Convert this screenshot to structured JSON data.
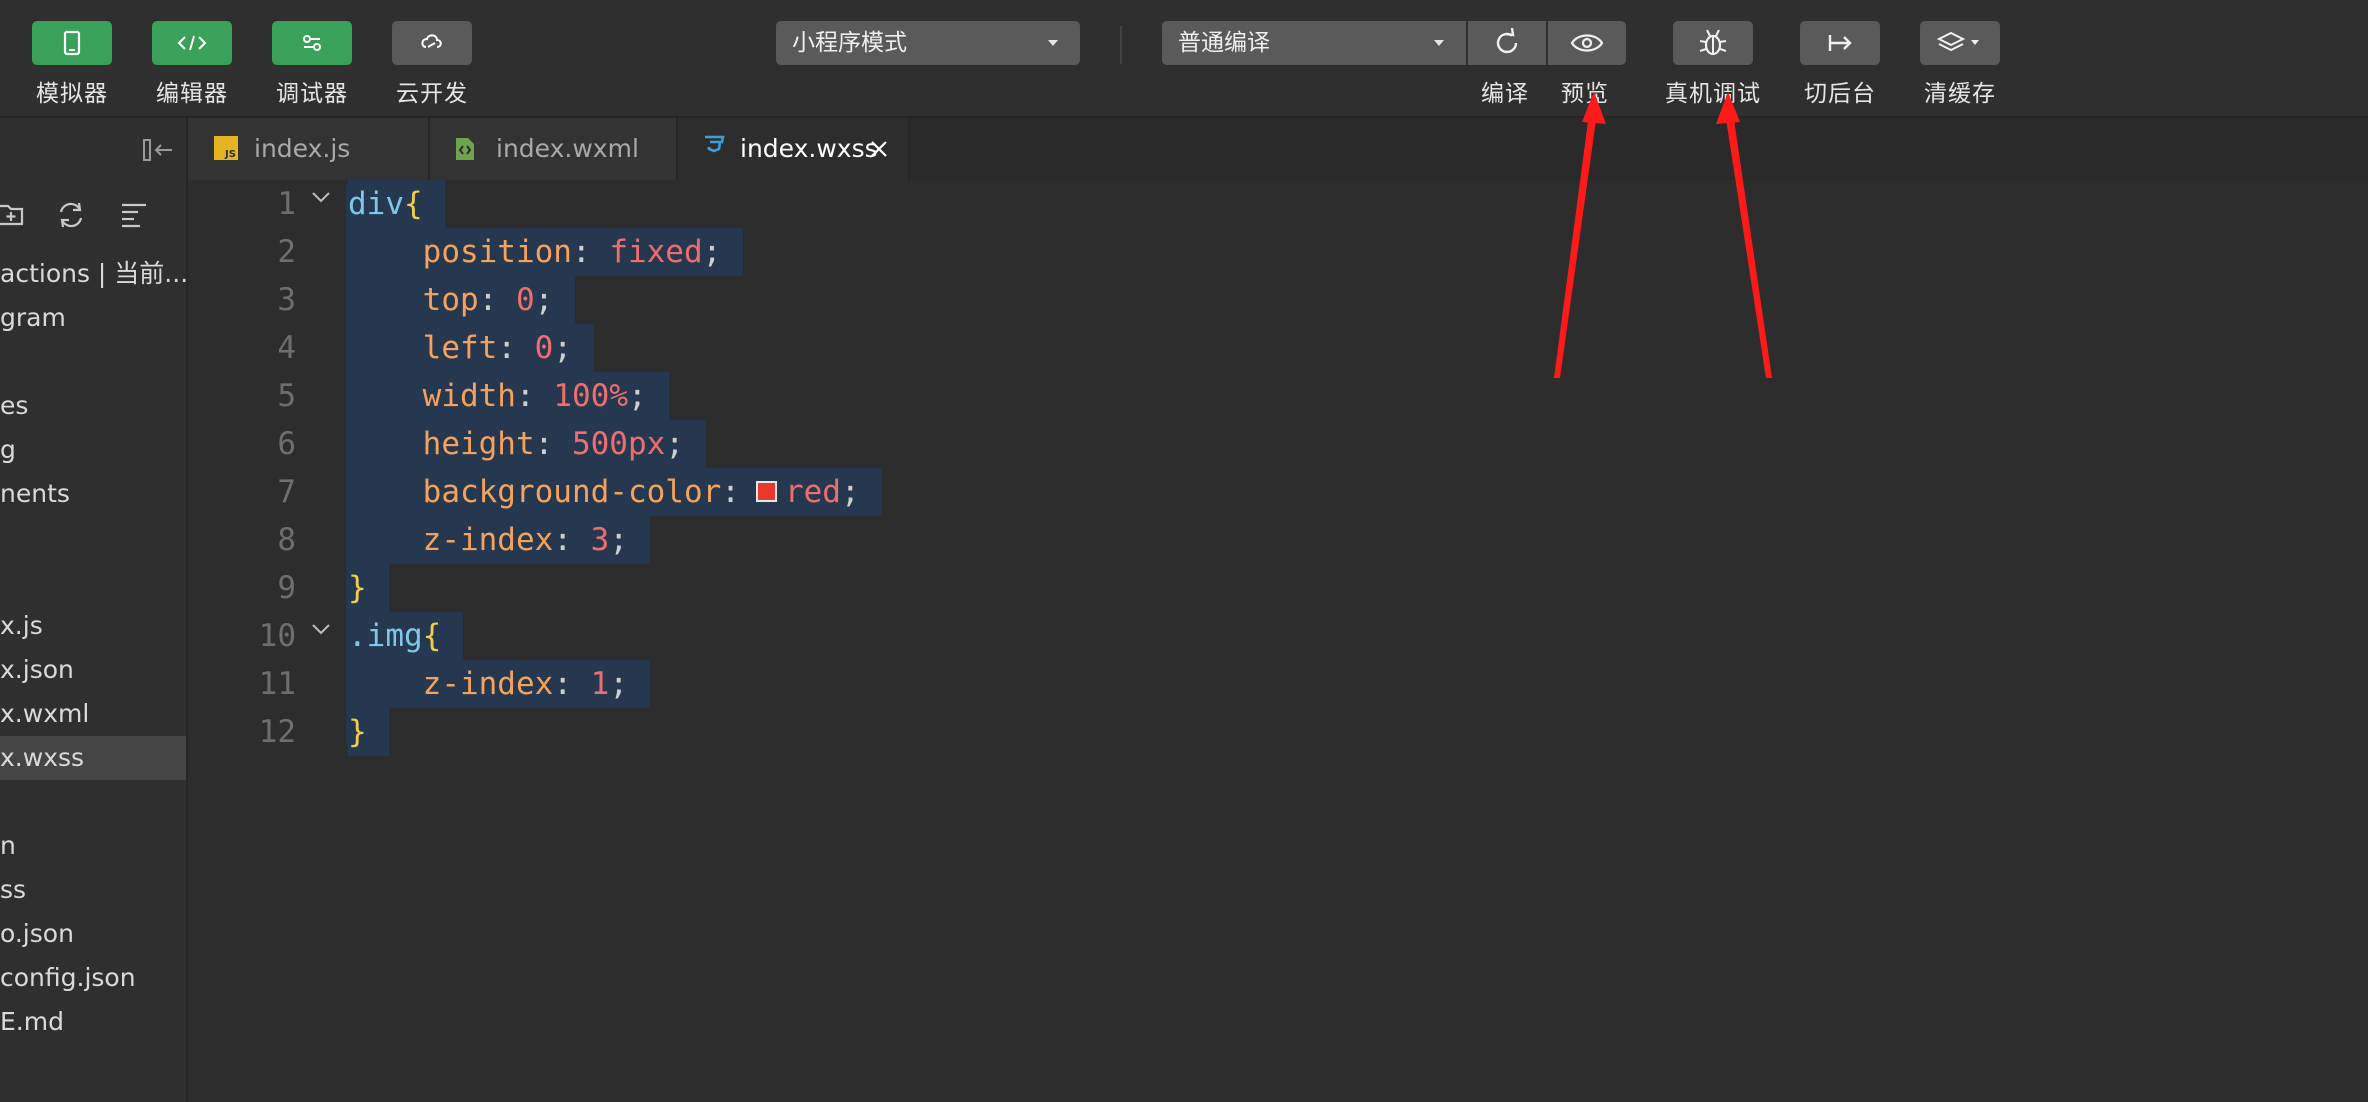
{
  "toolbar": {
    "simulator": "模拟器",
    "editor": "编辑器",
    "debugger": "调试器",
    "cloud": "云开发",
    "mode_select": "小程序模式",
    "compile_select": "普通编译",
    "compile": "编译",
    "preview": "预览",
    "device_debug": "真机调试",
    "background": "切后台",
    "clear_cache": "清缓存"
  },
  "sidebar": {
    "items": [
      {
        "label": "actions | 当前..."
      },
      {
        "label": "gram"
      },
      {
        "label": "es"
      },
      {
        "label": "g"
      },
      {
        "label": "nents"
      },
      {
        "label": "x.js"
      },
      {
        "label": "x.json"
      },
      {
        "label": "x.wxml"
      },
      {
        "label": "x.wxss"
      },
      {
        "label": "n"
      },
      {
        "label": "ss"
      },
      {
        "label": "o.json"
      },
      {
        "label": "config.json"
      },
      {
        "label": "E.md"
      }
    ]
  },
  "tabs": [
    {
      "label": "index.js"
    },
    {
      "label": "index.wxml"
    },
    {
      "label": "index.wxss"
    }
  ],
  "editor": {
    "lines": [
      {
        "num": "1",
        "sel": "div",
        "open": "{"
      },
      {
        "num": "2",
        "prop": "position",
        "value": "fixed"
      },
      {
        "num": "3",
        "prop": "top",
        "value": "0"
      },
      {
        "num": "4",
        "prop": "left",
        "value": "0"
      },
      {
        "num": "5",
        "prop": "width",
        "value": "100%"
      },
      {
        "num": "6",
        "prop": "height",
        "value": "500px"
      },
      {
        "num": "7",
        "prop": "background-color",
        "value": "red"
      },
      {
        "num": "8",
        "prop": "z-index",
        "value": "3"
      },
      {
        "num": "9",
        "close": "}"
      },
      {
        "num": "10",
        "sel": ".img",
        "open": "{"
      },
      {
        "num": "11",
        "prop": "z-index",
        "value": "1"
      },
      {
        "num": "12",
        "close": "}"
      }
    ],
    "colon": ":",
    "semi": ";",
    "swatch_color": "#e8392b"
  },
  "colors": {
    "accent_green": "#3aa15a",
    "arrow_red": "#ff1a1a"
  }
}
